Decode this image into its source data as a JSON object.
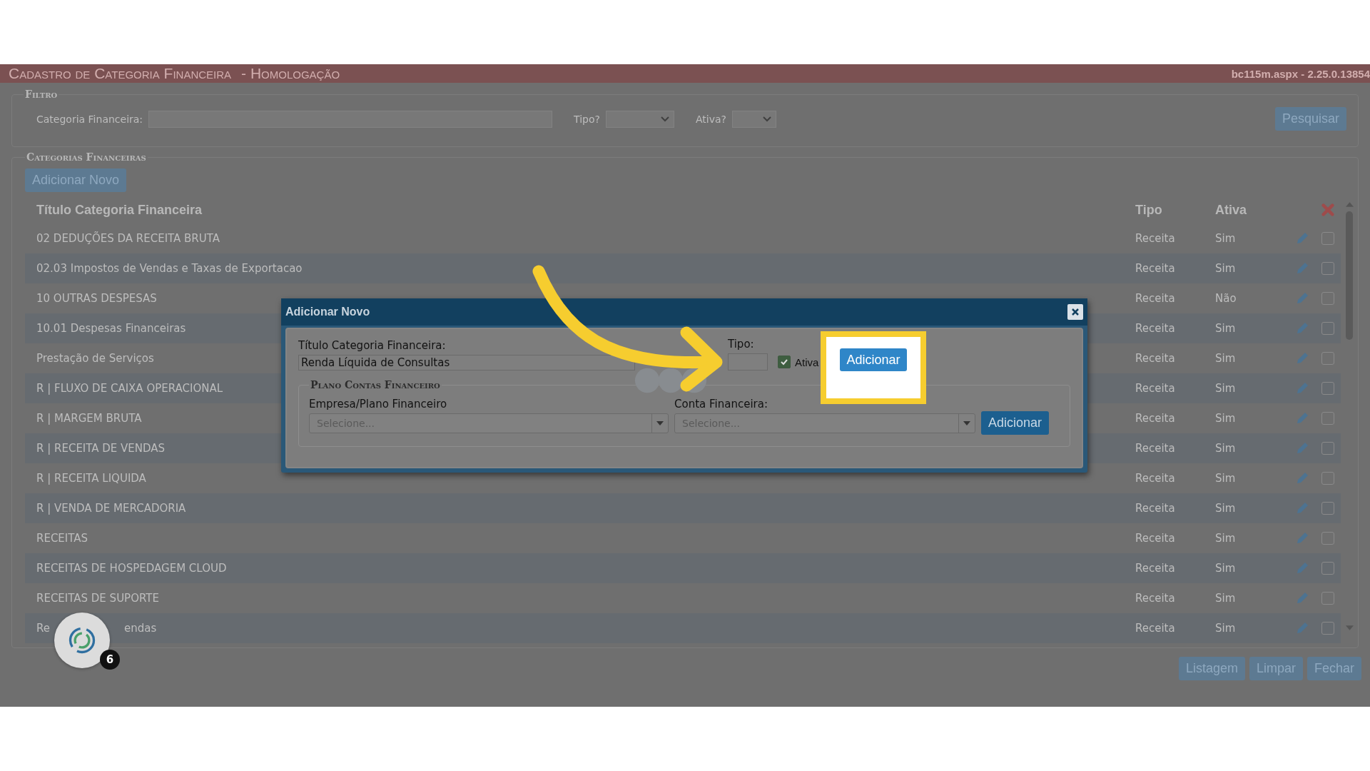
{
  "header": {
    "title": "Cadastro de Categoria Financeira",
    "environment": "- Homologação",
    "version": "bc115m.aspx - 2.25.0.13854"
  },
  "filter": {
    "legend": "Filtro",
    "category_label": "Categoria Financeira:",
    "tipo_label": "Tipo?",
    "ativa_label": "Ativa?",
    "search_button": "Pesquisar"
  },
  "categories": {
    "legend": "Categorias Financeiras",
    "add_button": "Adicionar Novo",
    "columns": [
      "Título Categoria Financeira",
      "Tipo",
      "Ativa"
    ],
    "rows": [
      {
        "title": [
          "02 DEDUÇÕES DA RECEITA BRUTA"
        ],
        "tipo": "Receita",
        "ativa": "Sim",
        "checked": false
      },
      {
        "title": [
          "02.03 Impostos de Vendas e Taxas de Exportacao"
        ],
        "tipo": "Receita",
        "ativa": "Sim",
        "checked": false
      },
      {
        "title": [
          "10 OUTRAS DESPESAS"
        ],
        "tipo": "Receita",
        "ativa": "Não",
        "checked": false
      },
      {
        "title": [
          "10.01 Despesas Financeiras"
        ],
        "tipo": "Receita",
        "ativa": "Sim",
        "checked": false
      },
      {
        "title": [
          "Prestação de Serviços"
        ],
        "tipo": "Receita",
        "ativa": "Sim",
        "checked": false
      },
      {
        "title": [
          "R | FLUXO DE CAIXA OPERACIONAL"
        ],
        "tipo": "Receita",
        "ativa": "Sim",
        "checked": false
      },
      {
        "title": [
          "R | MARGEM BRUTA"
        ],
        "tipo": "Receita",
        "ativa": "Sim",
        "checked": false
      },
      {
        "title": [
          "R | RECEITA DE VENDAS"
        ],
        "tipo": "Receita",
        "ativa": "Sim",
        "checked": false
      },
      {
        "title": [
          "R | RECEITA LIQUIDA"
        ],
        "tipo": "Receita",
        "ativa": "Sim",
        "checked": false
      },
      {
        "title": [
          "R | VENDA DE MERCADORIA"
        ],
        "tipo": "Receita",
        "ativa": "Sim",
        "checked": false
      },
      {
        "title": [
          "RECEITAS"
        ],
        "tipo": "Receita",
        "ativa": "Sim",
        "checked": false
      },
      {
        "title": [
          "RECEITAS DE HOSPEDAGEM CLOUD"
        ],
        "tipo": "Receita",
        "ativa": "Sim",
        "checked": false
      },
      {
        "title": [
          "RECEITAS DE SUPORTE"
        ],
        "tipo": "Receita",
        "ativa": "Sim",
        "checked": false
      },
      {
        "title": [
          "Re",
          "endas"
        ],
        "tipo": "Receita",
        "ativa": "Sim",
        "checked": false
      }
    ]
  },
  "footer_buttons": [
    "Listagem",
    "Limpar",
    "Fechar"
  ],
  "modal": {
    "title": "Adicionar Novo",
    "title_label": "Título Categoria Financeira:",
    "title_value": "Renda Líquida de Consultas",
    "tipo_label": "Tipo:",
    "ativa_label": "Ativa",
    "ativa_checked": true,
    "add_button": "Adicionar",
    "plan": {
      "legend": "Plano Contas Financeiro",
      "empresa_label": "Empresa/Plano Financeiro",
      "empresa_placeholder": "Selecione...",
      "conta_label": "Conta Financeira:",
      "conta_placeholder": "Selecione...",
      "add_button": "Adicionar"
    }
  },
  "chat_widget": {
    "badge": "6"
  }
}
